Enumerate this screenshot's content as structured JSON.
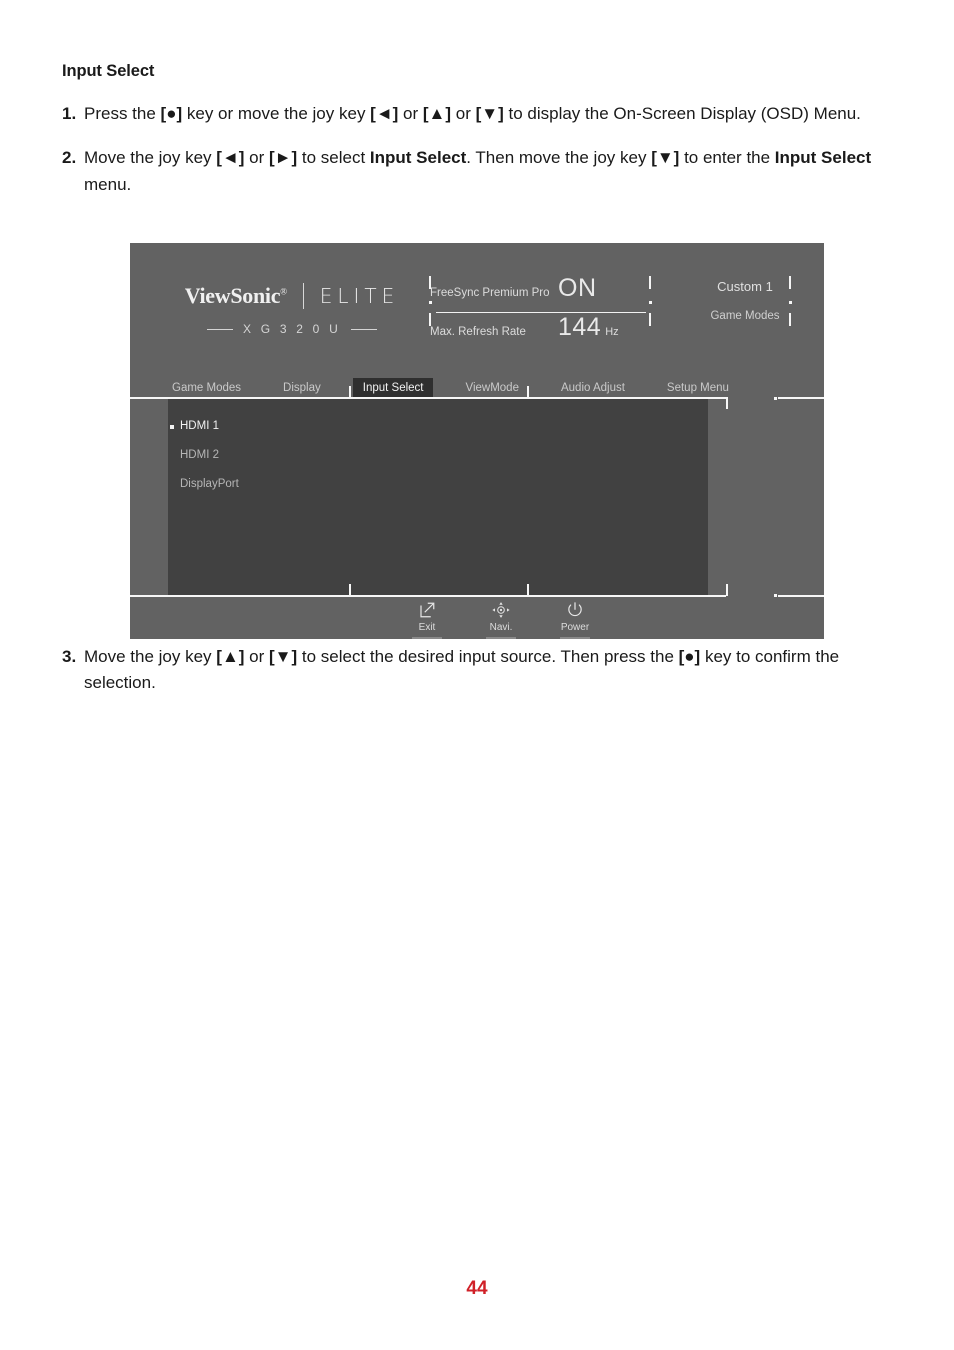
{
  "document": {
    "section_heading": "Input Select",
    "page_number": "44",
    "page_number_color": "#d02128",
    "steps": [
      {
        "number": "1.",
        "segments": [
          {
            "text": "Press the ",
            "bold": false
          },
          {
            "text": "[●]",
            "bold": true
          },
          {
            "text": " key or move the joy key ",
            "bold": false
          },
          {
            "text": "[◄]",
            "bold": true
          },
          {
            "text": " or ",
            "bold": false
          },
          {
            "text": "[▲]",
            "bold": true
          },
          {
            "text": " or ",
            "bold": false
          },
          {
            "text": "[▼]",
            "bold": true
          },
          {
            "text": " to display the On-Screen Display (OSD) Menu.",
            "bold": false
          }
        ]
      },
      {
        "number": "2.",
        "segments": [
          {
            "text": "Move the joy key ",
            "bold": false
          },
          {
            "text": "[◄]",
            "bold": true
          },
          {
            "text": " or ",
            "bold": false
          },
          {
            "text": "[►]",
            "bold": true
          },
          {
            "text": " to select ",
            "bold": false
          },
          {
            "text": "Input Select",
            "bold": true
          },
          {
            "text": ". Then move the joy key ",
            "bold": false
          },
          {
            "text": "[▼]",
            "bold": true
          },
          {
            "text": " to enter the ",
            "bold": false
          },
          {
            "text": "Input Select",
            "bold": true
          },
          {
            "text": " menu.",
            "bold": false
          }
        ]
      },
      {
        "number": "3.",
        "segments": [
          {
            "text": "Move the joy key ",
            "bold": false
          },
          {
            "text": "[▲]",
            "bold": true
          },
          {
            "text": " or ",
            "bold": false
          },
          {
            "text": "[▼]",
            "bold": true
          },
          {
            "text": " to select the desired input source. Then press the ",
            "bold": false
          },
          {
            "text": "[●]",
            "bold": true
          },
          {
            "text": " key to confirm the selection.",
            "bold": false
          }
        ]
      }
    ]
  },
  "osd": {
    "background_color": "#626262",
    "panel_color": "#414141",
    "accent_color": "#f7f7f7",
    "brand": {
      "company": "ViewSonic",
      "trademark": "®",
      "line": "ELITE",
      "model": "X G 3 2 0 U"
    },
    "info": {
      "freesync_label": "FreeSync Premium Pro",
      "freesync_value": "ON",
      "refresh_label": "Max. Refresh Rate",
      "refresh_value": "144",
      "refresh_unit": "Hz"
    },
    "mode": {
      "preset": "Custom 1",
      "category": "Game Modes"
    },
    "tabs": [
      {
        "label": "Game Modes",
        "active": false
      },
      {
        "label": "Display",
        "active": false
      },
      {
        "label": "Input Select",
        "active": true
      },
      {
        "label": "ViewMode",
        "active": false
      },
      {
        "label": "Audio Adjust",
        "active": false
      },
      {
        "label": "Setup Menu",
        "active": false
      }
    ],
    "menu_items": [
      {
        "label": "HDMI 1",
        "selected": true
      },
      {
        "label": "HDMI 2",
        "selected": false
      },
      {
        "label": "DisplayPort",
        "selected": false
      }
    ],
    "buttons": [
      {
        "label": "Exit",
        "icon": "exit-arrow-icon"
      },
      {
        "label": "Navi.",
        "icon": "joystick-navigate-icon"
      },
      {
        "label": "Power",
        "icon": "power-icon"
      }
    ]
  }
}
